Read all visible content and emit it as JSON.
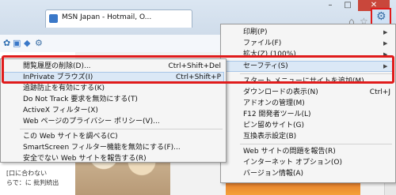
{
  "browser": {
    "tab_title": "MSN Japan - Hotmail, O...",
    "window_buttons": [
      "–",
      "□",
      "✕"
    ]
  },
  "tools_menu": {
    "items": [
      {
        "label": "印刷(P)",
        "arrow": true
      },
      {
        "label": "ファイル(F)",
        "arrow": true
      },
      {
        "label": "拡大(Z) (100%)",
        "arrow": true
      },
      {
        "label": "セーフティ(S)",
        "arrow": true,
        "highlighted": true
      },
      {
        "label": "スタート メニューにサイトを追加(M)"
      },
      {
        "label": "ダウンロードの表示(N)",
        "shortcut": "Ctrl+J"
      },
      {
        "label": "アドオンの管理(M)"
      },
      {
        "label": "F12 開発者ツール(L)"
      },
      {
        "label": "ピン留めサイト(G)"
      },
      {
        "label": "互換表示設定(B)"
      },
      {
        "label": "Web サイトの問題を報告(R)"
      },
      {
        "label": "インターネット オプション(O)"
      },
      {
        "label": "バージョン情報(A)"
      }
    ]
  },
  "safety_menu": {
    "items": [
      {
        "label": "閲覧履歴の削除(D)...",
        "shortcut": "Ctrl+Shift+Del"
      },
      {
        "label": "InPrivate ブラウズ(I)",
        "shortcut": "Ctrl+Shift+P"
      },
      {
        "label": "追跡防止を有効にする(K)"
      },
      {
        "label": "Do Not Track 要求を無効にする(T)"
      },
      {
        "label": "ActiveX フィルター(X)"
      },
      {
        "label": "Web ページのプライバシー ポリシー(V)..."
      },
      {
        "label": "この Web サイトを調べる(C)"
      },
      {
        "label": "SmartScreen フィルター機能を無効にする(F)..."
      },
      {
        "label": "安全でない Web サイトを報告する(R)"
      }
    ]
  },
  "page": {
    "snippet1": "[口に合わない",
    "snippet2": "らで：に 批判続出"
  },
  "colors": {
    "highlight_box": "#e01b1b",
    "menu_hover": "#dbe8f6"
  }
}
